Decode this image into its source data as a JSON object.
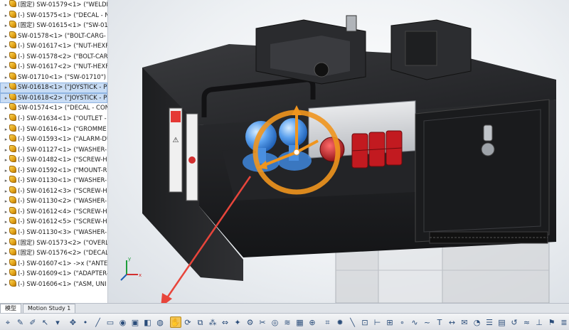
{
  "tree": {
    "items": [
      {
        "label": "(固定) SW-01579<1> (\"WELDM",
        "selected": false
      },
      {
        "label": "(-) SW-01575<1> (\"DECAL - N",
        "selected": false
      },
      {
        "label": "(固定) SW-01615<1> (\"SW-01",
        "selected": false
      },
      {
        "label": "SW-01578<1> (\"BOLT-CARG-",
        "selected": false
      },
      {
        "label": "(-) SW-01617<1> (\"NUT-HEXF",
        "selected": false
      },
      {
        "label": "(-) SW-01578<2> (\"BOLT-CARG-",
        "selected": false
      },
      {
        "label": "(-) SW-01617<2> (\"NUT-HEXF",
        "selected": false
      },
      {
        "label": "SW-01710<1> (\"SW-01710\") -",
        "selected": false
      },
      {
        "label": "SW-01618<1> (\"JOYSTICK - P",
        "selected": true
      },
      {
        "label": "SW-01618<2> (\"JOYSTICK - P",
        "selected": true
      },
      {
        "label": "SW-01574<1> (\"DECAL - CON",
        "selected": false
      },
      {
        "label": "(-) SW-01634<1> (\"OUTLET -",
        "selected": false
      },
      {
        "label": "(-) SW-01616<1> (\"GROMME",
        "selected": false
      },
      {
        "label": "(-) SW-01593<1> (\"ALARM-DU",
        "selected": false
      },
      {
        "label": "(-) SW-01127<1> (\"WASHER-F",
        "selected": false
      },
      {
        "label": "(-) SW-01482<1> (\"SCREW-HX",
        "selected": false
      },
      {
        "label": "(-) SW-01592<1> (\"MOUNT-R",
        "selected": false
      },
      {
        "label": "(-) SW-01130<1> (\"WASHER-F",
        "selected": false
      },
      {
        "label": "(-) SW-01612<3> (\"SCREW-HX",
        "selected": false
      },
      {
        "label": "(-) SW-01130<2> (\"WASHER-F",
        "selected": false
      },
      {
        "label": "(-) SW-01612<4> (\"SCREW-HX",
        "selected": false
      },
      {
        "label": "(-) SW-01612<5> (\"SCREW-HX",
        "selected": false
      },
      {
        "label": "(-) SW-01130<3> (\"WASHER-F",
        "selected": false
      },
      {
        "label": "(固定) SW-01573<2> (\"OVERL",
        "selected": false
      },
      {
        "label": "(固定) SW-01576<2> (\"DECAL",
        "selected": false
      },
      {
        "label": "(-) SW-01607<1> ->x (\"ANTEN",
        "selected": false
      },
      {
        "label": "(-) SW-01609<1> (\"ADAPTER-",
        "selected": false
      },
      {
        "label": "(-) SW-01606<1> (\"ASM, UNI",
        "selected": false
      }
    ]
  },
  "tabs": [
    {
      "label": "模型",
      "active": true
    },
    {
      "label": "Motion Study 1",
      "active": false
    }
  ],
  "viewport": {
    "arrow_color": "#e8453b",
    "triad_color": "#f0951e",
    "selection_color": "#5aa0ee",
    "decal_text": "⚠"
  },
  "toolbar": {
    "icons": [
      "select-icon",
      "sketch-icon",
      "pen-icon",
      "pointer-icon",
      "dropdown-icon",
      "move-icon",
      "point-icon",
      "line-icon",
      "plane-icon",
      "camera-icon",
      "cube-icon",
      "view-icon",
      "sphere-icon",
      "move-component-icon",
      "rotate-icon",
      "mate-icon",
      "pattern-icon",
      "mirror-icon",
      "smart-icon",
      "fastener-icon",
      "cut-icon",
      "hole-icon",
      "weld-icon",
      "section-icon",
      "bolt-icon",
      "measure-icon",
      "explode-icon",
      "line2-icon",
      "ref-icon",
      "axis-icon",
      "coord-icon",
      "point2-icon",
      "curve-icon",
      "spline-icon",
      "text-icon",
      "dim-icon",
      "note-icon",
      "balloon-icon",
      "bom-icon",
      "table-icon",
      "revision-icon",
      "weld2-icon",
      "datum-icon",
      "flag-icon",
      "stack-icon",
      "hatch-icon",
      "center-icon",
      "chamfer-icon",
      "rebuild-icon",
      "options-icon"
    ],
    "active_index": 13
  }
}
